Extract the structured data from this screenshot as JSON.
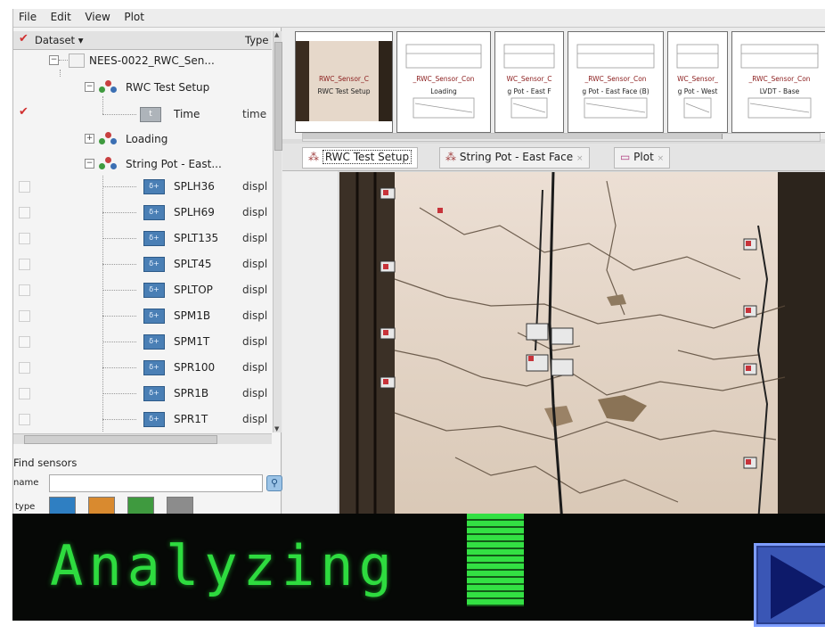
{
  "menu": [
    "File",
    "Edit",
    "View",
    "Plot"
  ],
  "table": {
    "header_dataset": "Dataset",
    "header_sort_arrow": "▾",
    "header_type": "Type"
  },
  "tree": {
    "root": "NEES-0022_RWC_Sen...",
    "setup": "RWC Test Setup",
    "time_label": "Time",
    "time_type": "time",
    "loading": "Loading",
    "stringpot": "String Pot - East...",
    "signals": [
      {
        "label": "SPLH36",
        "type": "displ"
      },
      {
        "label": "SPLH69",
        "type": "displ"
      },
      {
        "label": "SPLT135",
        "type": "displ"
      },
      {
        "label": "SPLT45",
        "type": "displ"
      },
      {
        "label": "SPLTOP",
        "type": "displ"
      },
      {
        "label": "SPM1B",
        "type": "displ"
      },
      {
        "label": "SPM1T",
        "type": "displ"
      },
      {
        "label": "SPR100",
        "type": "displ"
      },
      {
        "label": "SPR1B",
        "type": "displ"
      },
      {
        "label": "SPR1T",
        "type": "displ"
      }
    ]
  },
  "find": {
    "title": "Find sensors",
    "name_label": "name",
    "type_label": "type",
    "type_buttons": [
      {
        "color": "#2f7fc2"
      },
      {
        "color": "#d98a2f"
      },
      {
        "color": "#3f9a3f"
      },
      {
        "color": "#8c8c8c"
      }
    ]
  },
  "thumbnails": [
    {
      "title": "RWC_Sensor_C",
      "subtitle": "RWC Test Setup",
      "photo": true
    },
    {
      "title": "_RWC_Sensor_Con",
      "subtitle": "Loading",
      "photo": false
    },
    {
      "title": "WC_Sensor_C",
      "subtitle": "g Pot - East F",
      "photo": false
    },
    {
      "title": "_RWC_Sensor_Con",
      "subtitle": "g Pot - East Face (B)",
      "photo": false
    },
    {
      "title": "WC_Sensor_",
      "subtitle": "g Pot - West",
      "photo": false
    },
    {
      "title": "_RWC_Sensor_Con",
      "subtitle": "LVDT - Base",
      "photo": false
    }
  ],
  "tabs": [
    {
      "label": "RWC Test Setup",
      "active": true
    },
    {
      "label": "String Pot - East Face",
      "active": false
    },
    {
      "label": "Plot",
      "active": false
    }
  ],
  "overlay": {
    "text": "Analyzing",
    "text_color": "#2edb3f",
    "play_color": "#3a56b5"
  }
}
